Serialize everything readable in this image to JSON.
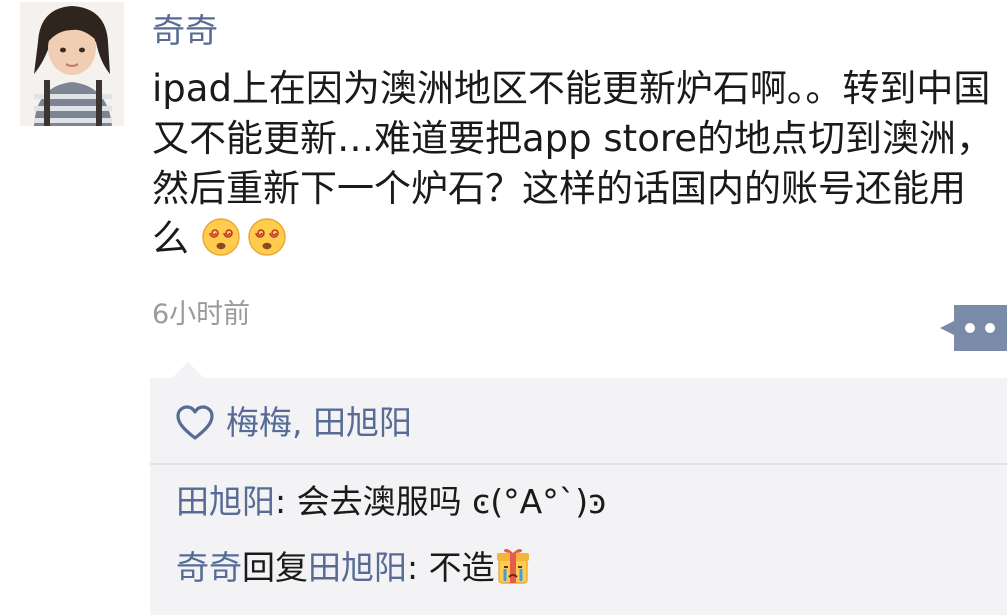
{
  "post": {
    "author": "奇奇",
    "content": "ipad上在因为澳洲地区不能更新炉石啊。。转到中国又不能更新…难道要把app store的地点切到澳洲，然后重新下一个炉石？这样的话国内的账号还能用么",
    "emoji": [
      "dizzy-face-icon",
      "dizzy-face-icon"
    ],
    "timestamp": "6小时前"
  },
  "likes": {
    "icon": "heart-outline-icon",
    "names": "梅梅, 田旭阳"
  },
  "comments": [
    {
      "author": "田旭阳",
      "separator": ": ",
      "text": "会去澳服吗 ͼ(°A°`)ͽ"
    },
    {
      "author": "奇奇",
      "reply_word": "回复",
      "reply_to": "田旭阳",
      "separator": ": ",
      "text": "不造",
      "emoji": "crying-gift-icon"
    }
  ],
  "colors": {
    "link_blue": "#576b95",
    "text": "#1a1a1a",
    "muted": "#9b9b9b",
    "reply_bg": "#f3f3f5",
    "more_button": "#7a8ba8"
  }
}
